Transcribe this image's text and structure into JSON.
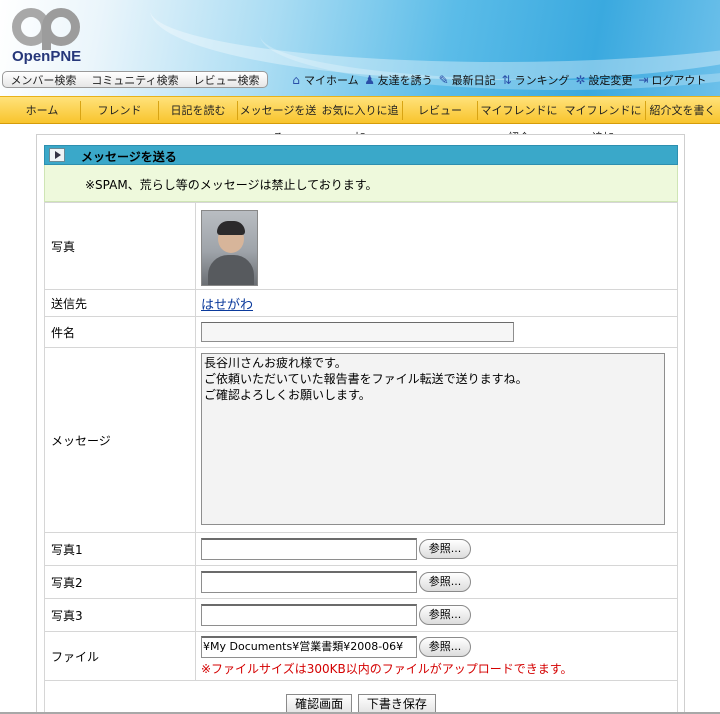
{
  "header": {
    "logo_text": "OpenPNE",
    "search_links": [
      "メンバー検索",
      "コミュニティ検索",
      "レビュー検索"
    ],
    "top_links": [
      {
        "label": "マイホーム",
        "icon": "home-icon",
        "glyph": "⌂"
      },
      {
        "label": "友達を誘う",
        "icon": "invite-friend-icon",
        "glyph": "♟"
      },
      {
        "label": "最新日記",
        "icon": "pen-icon",
        "glyph": "✎"
      },
      {
        "label": "ランキング",
        "icon": "ranking-icon",
        "glyph": "⇅"
      },
      {
        "label": "設定変更",
        "icon": "settings-gear-icon",
        "glyph": "✲"
      },
      {
        "label": "ログアウト",
        "icon": "logout-icon",
        "glyph": "⇥"
      }
    ]
  },
  "nav": {
    "items": [
      "ホーム",
      "フレンド",
      "日記を読む",
      "メッセージを送る",
      "お気に入りに追加",
      "レビュー",
      "マイフレンドに紹介",
      "マイフレンドに追加",
      "紹介文を書く"
    ]
  },
  "form": {
    "title": "メッセージを送る",
    "notice": "※SPAM、荒らし等のメッセージは禁止しております。",
    "labels": {
      "photo": "写真",
      "recipient": "送信先",
      "subject": "件名",
      "message": "メッセージ",
      "photo1": "写真1",
      "photo2": "写真2",
      "photo3": "写真3",
      "file": "ファイル"
    },
    "recipient_name": "はせがわ",
    "subject_value": "",
    "message_value": "長谷川さんお疲れ様です。\nご依頼いただいていた報告書をファイル転送で送りますね。\nご確認よろしくお願いします。",
    "photo1_value": "",
    "photo2_value": "",
    "photo3_value": "",
    "file_value": "¥My Documents¥営業書類¥2008-06¥",
    "browse_label": "参照...",
    "file_note": "※ファイルサイズは300KB以内のファイルがアップロードできます。",
    "confirm_button": "確認画面",
    "draft_button": "下書き保存"
  }
}
